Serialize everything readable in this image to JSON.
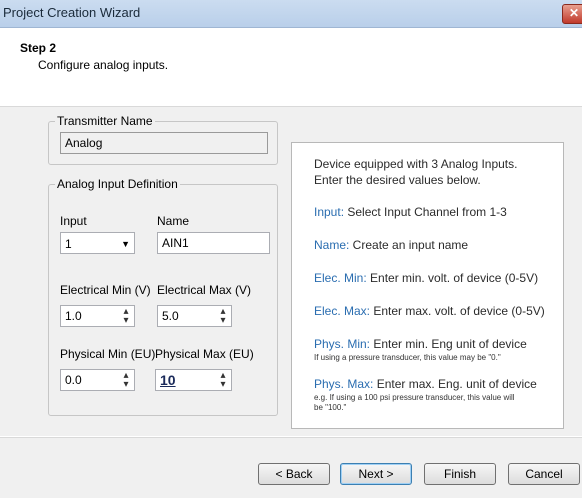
{
  "window": {
    "title": "Project Creation Wizard",
    "close_glyph": "✕"
  },
  "step": {
    "title": "Step 2",
    "description": "Configure analog inputs."
  },
  "transmitter": {
    "group_label": "Transmitter Name",
    "value": "Analog"
  },
  "analog": {
    "group_label": "Analog Input Definition",
    "input_label": "Input",
    "input_value": "1",
    "name_label": "Name",
    "name_value": "AIN1",
    "elec_min_label": "Electrical Min (V)",
    "elec_min_value": "1.0",
    "elec_max_label": "Electrical Max (V)",
    "elec_max_value": "5.0",
    "phys_min_label": "Physical Min (EU)",
    "phys_min_value": "0.0",
    "phys_max_label": "Physical Max (EU)",
    "phys_max_value": "10"
  },
  "info": {
    "intro1": "Device equipped with 3 Analog Inputs.",
    "intro2": "Enter the desired values below.",
    "input_key": "Input:",
    "input_text": " Select Input Channel from 1-3",
    "name_key": "Name:",
    "name_text": " Create an input name",
    "elecmin_key": "Elec. Min:",
    "elecmin_text": " Enter min. volt. of device (0-5V)",
    "elecmax_key": "Elec. Max:",
    "elecmax_text": " Enter max. volt. of device (0-5V)",
    "physmin_key": "Phys. Min:",
    "physmin_text": " Enter min. Eng unit of device",
    "physmin_note": "If using a pressure transducer, this value may be \"0.\"",
    "physmax_key": "Phys. Max:",
    "physmax_text": " Enter max. Eng. unit of device",
    "physmax_note1": "e.g. If using a 100 psi pressure transducer, this value will",
    "physmax_note2": "be \"100.\""
  },
  "buttons": {
    "back": "< Back",
    "next": "Next >",
    "finish": "Finish",
    "cancel": "Cancel"
  },
  "colors": {
    "accent_text": "#2a6db0",
    "close_red": "#c0392b"
  }
}
